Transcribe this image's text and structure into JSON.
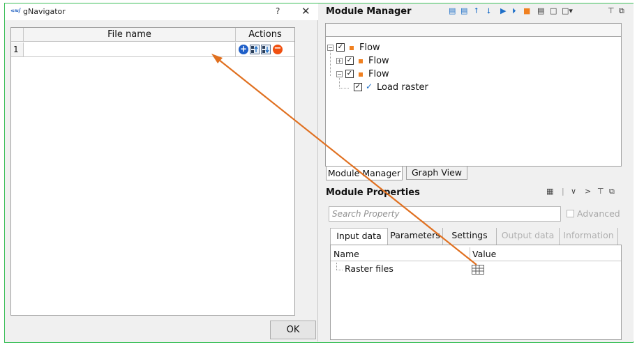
{
  "gnavigator": {
    "logo": "«≈/",
    "title": "gNavigator",
    "help": "?",
    "close": "✕",
    "table": {
      "headers": {
        "file_name": "File name",
        "actions": "Actions"
      },
      "rows": [
        {
          "index": "1",
          "file_name": ""
        }
      ],
      "action_icons": [
        "add-icon",
        "move-up-icon",
        "move-down-icon",
        "remove-icon"
      ]
    },
    "ok_label": "OK"
  },
  "module_manager": {
    "title": "Module Manager",
    "toolbar_icons": [
      "add-module-icon",
      "remove-module-icon",
      "move-up-icon",
      "move-down-icon",
      "run-icon",
      "run-step-icon",
      "stop-icon",
      "list-icon",
      "new-icon",
      "new-menu-icon",
      "pin-icon",
      "float-icon"
    ],
    "tree": [
      {
        "label": "Flow",
        "level": 0,
        "expander": "−",
        "checked": true,
        "marker": "square"
      },
      {
        "label": "Flow",
        "level": 1,
        "expander": "+",
        "checked": true,
        "marker": "square"
      },
      {
        "label": "Flow",
        "level": 1,
        "expander": "−",
        "checked": true,
        "marker": "square"
      },
      {
        "label": "Load raster",
        "level": 2,
        "expander": "",
        "checked": true,
        "marker": "tick"
      }
    ],
    "tabs": [
      "Module Manager",
      "Graph View"
    ],
    "active_tab": "Module Manager"
  },
  "module_properties": {
    "title": "Module Properties",
    "search_placeholder": "Search Property",
    "advanced_label": "Advanced",
    "advanced_checked": false,
    "tabs": [
      {
        "label": "Input data",
        "enabled": true,
        "active": true
      },
      {
        "label": "Parameters",
        "enabled": true,
        "active": false
      },
      {
        "label": "Settings",
        "enabled": true,
        "active": false
      },
      {
        "label": "Output data",
        "enabled": false,
        "active": false
      },
      {
        "label": "Information",
        "enabled": false,
        "active": false
      }
    ],
    "columns": {
      "name": "Name",
      "value": "Value"
    },
    "rows": [
      {
        "name": "Raster files",
        "value_icon": "table-icon"
      }
    ]
  },
  "annotation": {
    "color": "#e07020",
    "from": "raster-files-value",
    "to": "file-name-cell"
  },
  "colors": {
    "window_border": "#3cbf5a",
    "accent": "#1e6fc8",
    "flow_marker": "#f08020"
  }
}
